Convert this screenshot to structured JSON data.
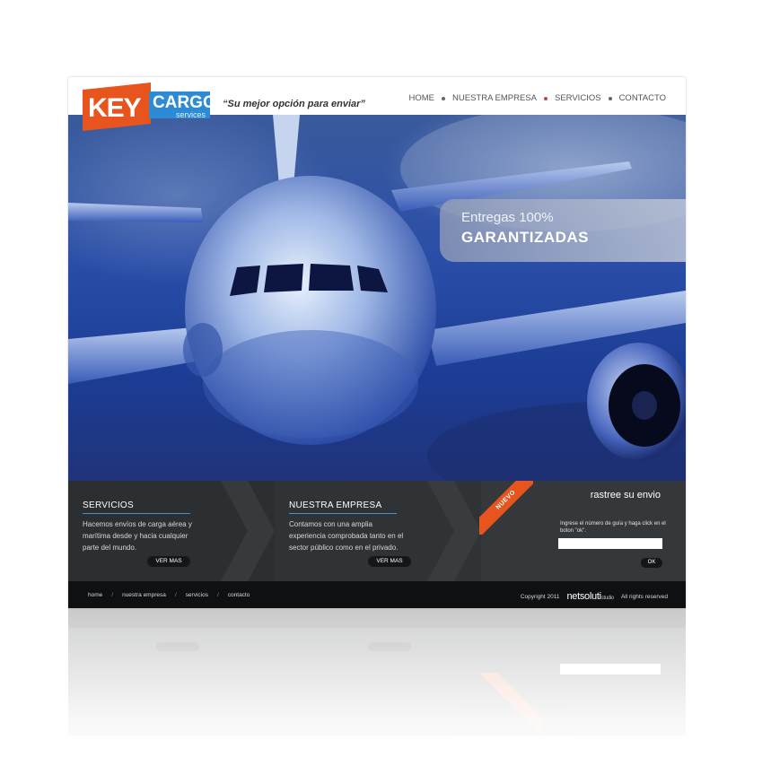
{
  "brand": {
    "logo_key": "KEY",
    "logo_cargo": "CARGO",
    "logo_services": "services",
    "tagline": "“Su mejor opción para enviar”",
    "colors": {
      "orange": "#e8541e",
      "blue": "#2d8bd6",
      "dark": "#2b2e30"
    }
  },
  "nav": {
    "items": [
      {
        "label": "HOME"
      },
      {
        "label": "NUESTRA EMPRESA"
      },
      {
        "label": "SERVICIOS"
      },
      {
        "label": "CONTACTO"
      }
    ]
  },
  "hero": {
    "badge_line1": "Entregas 100%",
    "badge_line2": "GARANTIZADAS"
  },
  "panels": {
    "servicios": {
      "title": "SERVICIOS",
      "text": "Hacemos envíos de carga aérea y marítima desde y hacia cualquier parte del mundo.",
      "button": "VER MAS"
    },
    "empresa": {
      "title": "NUESTRA EMPRESA",
      "text": "Contamos con una amplia experiencia comprobada tanto en el sector público como en el privado.",
      "button": "VER MAS"
    },
    "tracking": {
      "ribbon": "NUEVO",
      "title": "rastree su envio",
      "instructions": "Ingrese el número de guía y haga click en el boton \"ok\".",
      "input_value": "",
      "button": "OK"
    }
  },
  "footer": {
    "links": [
      {
        "label": "home"
      },
      {
        "label": "nuestra empresa"
      },
      {
        "label": "servicios"
      },
      {
        "label": "contacto"
      }
    ],
    "separator": "/",
    "copyright": "Copyright 2011",
    "credit": "netsoluti",
    "credit_suffix": "studio",
    "rights": "All rights reserved"
  }
}
